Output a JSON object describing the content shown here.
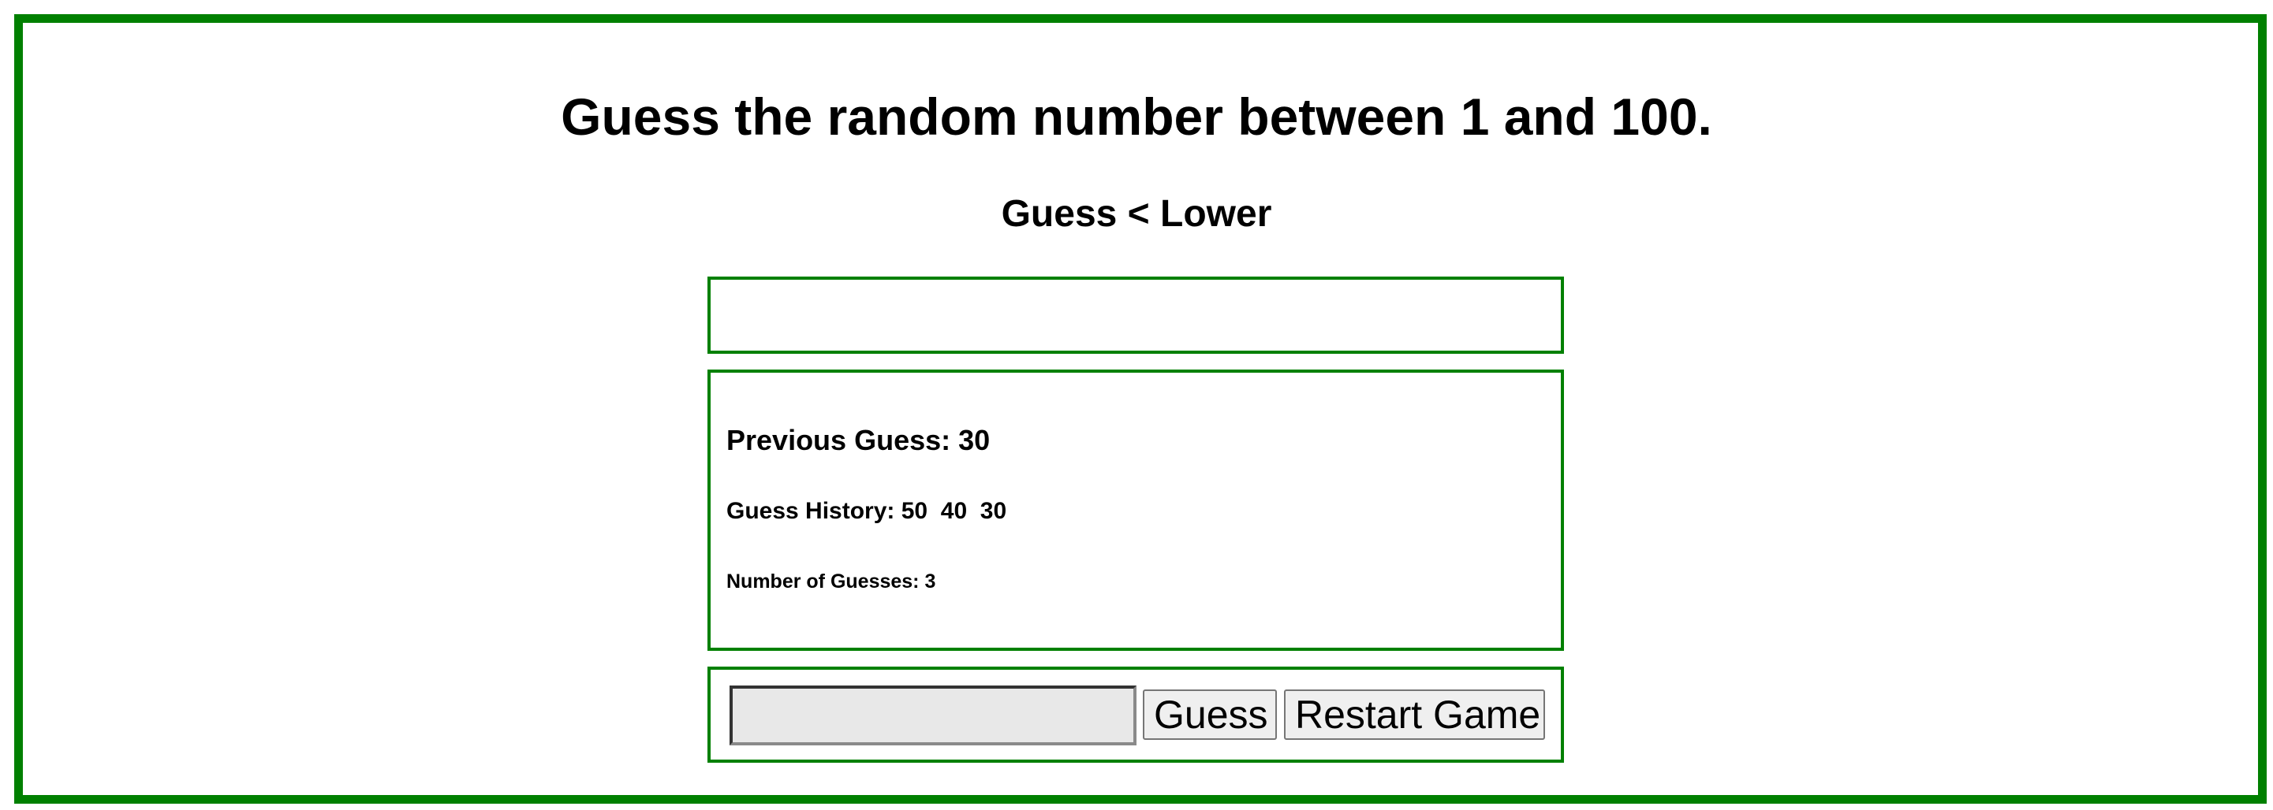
{
  "app": {
    "title": "Guess the random number between 1 and 100.",
    "hint": "Guess < Lower",
    "result_message": ""
  },
  "history_panel": {
    "previous_guess_label": "Previous Guess: 30",
    "guess_history_label": "Guess History: 50  40  30",
    "guess_count_label": "Number of Guesses: 3"
  },
  "controls": {
    "input_value": "",
    "input_placeholder": "",
    "guess_button_label": "Guess",
    "restart_button_label": "Restart Game"
  },
  "colors": {
    "border_green": "#008000",
    "input_background": "#e8e8e8",
    "button_background": "#efefef"
  }
}
